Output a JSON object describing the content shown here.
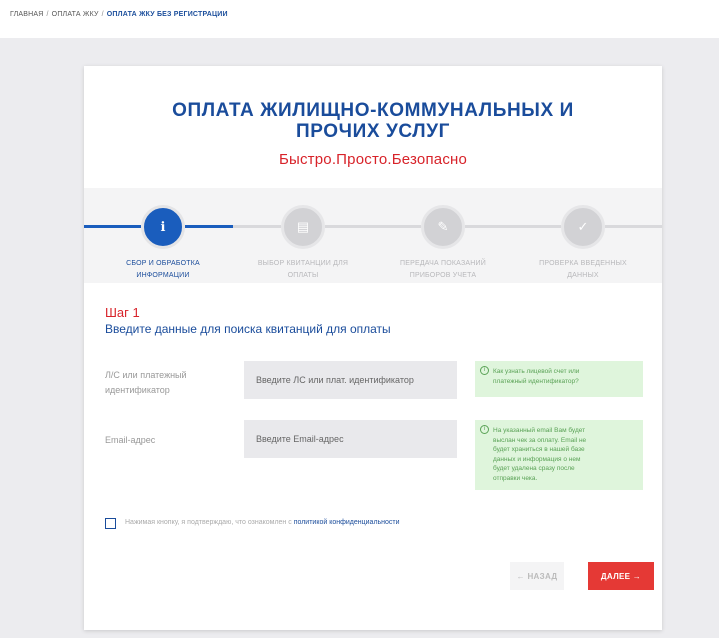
{
  "breadcrumb": {
    "items": [
      "ГЛАВНАЯ",
      "ОПЛАТА ЖКУ",
      "ОПЛАТА ЖКУ БЕЗ РЕГИСТРАЦИИ"
    ],
    "separator": "/"
  },
  "header": {
    "title_line1": "ОПЛАТА ЖИЛИЩНО-КОММУНАЛЬНЫХ И",
    "title_line2": "ПРОЧИХ УСЛУГ",
    "subtitle": "Быстро.Просто.Безопасно"
  },
  "stepper": {
    "steps": [
      {
        "label_line1": "СБОР И ОБРАБОТКА",
        "label_line2": "ИНФОРМАЦИИ",
        "icon": "info-icon",
        "glyph": "ℹ",
        "active": true
      },
      {
        "label_line1": "ВЫБОР КВИТАНЦИИ ДЛЯ",
        "label_line2": "ОПЛАТЫ",
        "icon": "document-icon",
        "glyph": "▤",
        "active": false
      },
      {
        "label_line1": "ПЕРЕДАЧА ПОКАЗАНИЙ",
        "label_line2": "ПРИБОРОВ УЧЕТА",
        "icon": "edit-icon",
        "glyph": "✎",
        "active": false
      },
      {
        "label_line1": "ПРОВЕРКА ВВЕДЕННЫХ",
        "label_line2": "ДАННЫХ",
        "icon": "check-icon",
        "glyph": "✓",
        "active": false
      }
    ]
  },
  "step": {
    "number": "Шаг 1",
    "description": "Введите данные для поиска квитанций для оплаты"
  },
  "form": {
    "account": {
      "label_line1": "Л/С или платежный",
      "label_line2": "идентификатор",
      "placeholder": "Введите ЛС или плат. идентификатор",
      "hint_line1": "Как узнать лицевой счет или",
      "hint_line2": "платежный идентификатор?"
    },
    "email": {
      "label": "Email-адрес",
      "placeholder": "Введите Email-адрес",
      "hint_lines": [
        "На указанный email Вам будет",
        "выслан чек за оплату. Email не",
        "будет храниться в нашей базе",
        "данных и информация о нем",
        "будет удалена сразу после",
        "отправки чека."
      ]
    },
    "consent": {
      "text": "Нажимая кнопку, я подтверждаю, что ознакомлен с ",
      "link": "политикой конфиденциальности"
    }
  },
  "buttons": {
    "back": "← НАЗАД",
    "next": "ДАЛЕЕ →"
  },
  "colors": {
    "primary": "#1a4c9b",
    "step_active": "#1a5dbd",
    "accent_red": "#d8232a",
    "button_red": "#e53935",
    "hint_bg": "#dff5dc",
    "hint_text": "#5aa256",
    "page_bg": "#ececef"
  }
}
